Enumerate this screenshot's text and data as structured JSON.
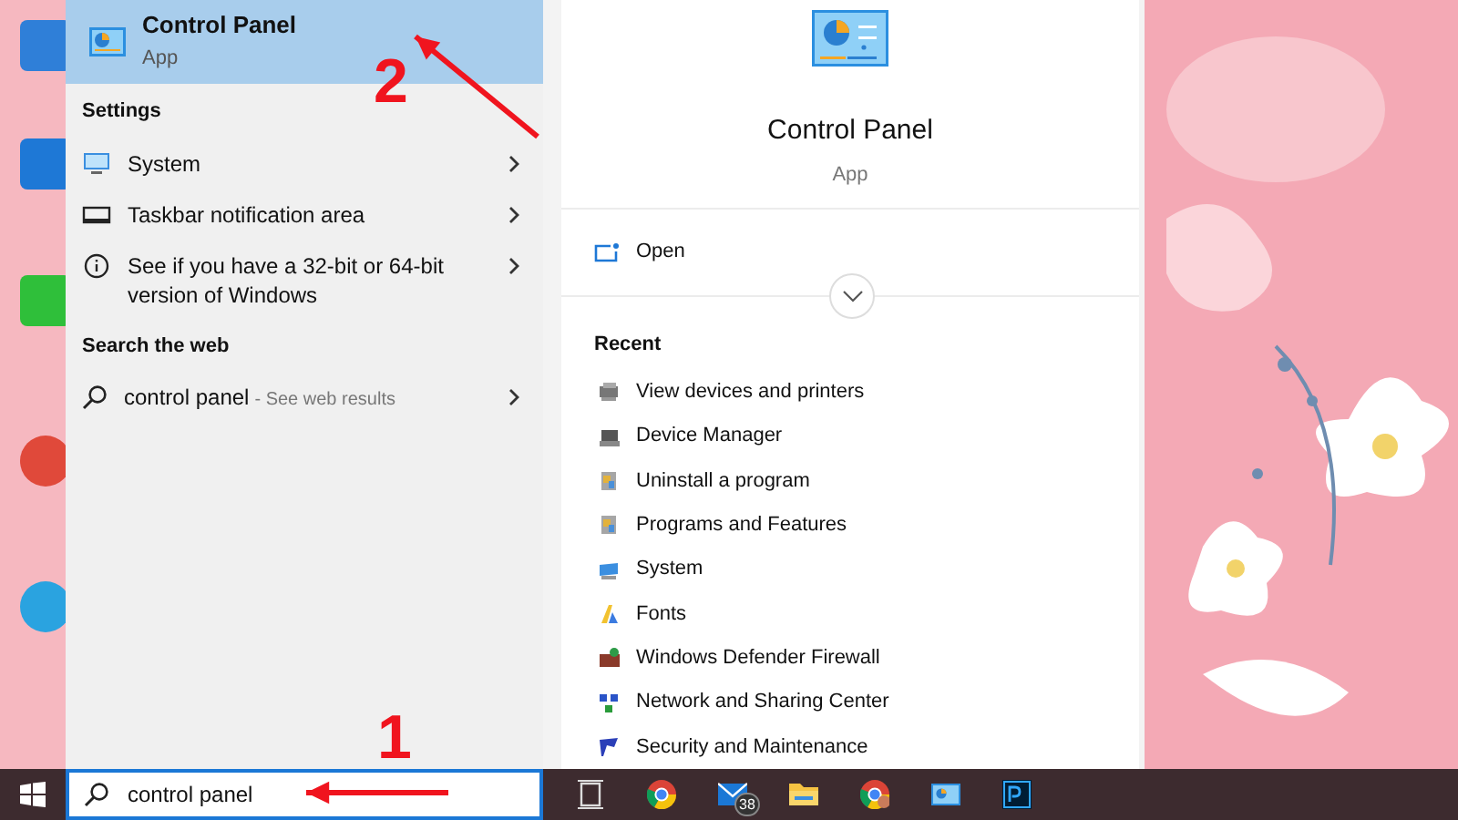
{
  "desktop": {
    "kind": "picture",
    "icons": [
      {
        "kind": "blue"
      },
      {
        "kind": "edge"
      },
      {
        "kind": "green"
      },
      {
        "kind": "chrome"
      },
      {
        "kind": "telegram"
      }
    ]
  },
  "best_match": {
    "title": "Control Panel",
    "subtitle": "App",
    "selected": true
  },
  "settings_heading": "Settings",
  "settings_items": [
    {
      "kind": "system",
      "label": "System"
    },
    {
      "kind": "taskbar",
      "label": "Taskbar notification area"
    },
    {
      "kind": "info",
      "label": "See if you have a 32-bit or 64-bit version of Windows"
    }
  ],
  "web_heading": "Search the web",
  "web_result": {
    "query": "control panel",
    "hint": "- See web results"
  },
  "detail": {
    "title": "Control Panel",
    "subtitle": "App",
    "action": "Open",
    "recent_heading": "Recent",
    "recent": [
      {
        "kind": "devices",
        "label": "View devices and printers"
      },
      {
        "kind": "device-manager",
        "label": "Device Manager"
      },
      {
        "kind": "programs",
        "label": "Uninstall a program"
      },
      {
        "kind": "programs",
        "label": "Programs and Features"
      },
      {
        "kind": "system",
        "label": "System"
      },
      {
        "kind": "fonts",
        "label": "Fonts"
      },
      {
        "kind": "firewall",
        "label": "Windows Defender Firewall"
      },
      {
        "kind": "network",
        "label": "Network and Sharing Center"
      },
      {
        "kind": "security",
        "label": "Security and Maintenance"
      }
    ]
  },
  "search": {
    "value": "control panel"
  },
  "taskbar": {
    "apps": [
      {
        "kind": "task-view"
      },
      {
        "kind": "chrome"
      },
      {
        "kind": "mail",
        "badge": "38"
      },
      {
        "kind": "folder"
      },
      {
        "kind": "chrome-profile"
      },
      {
        "kind": "control-panel"
      },
      {
        "kind": "photoshop"
      }
    ]
  },
  "annotations": [
    {
      "number": "2",
      "kind": "best-match"
    },
    {
      "number": "1",
      "kind": "search"
    }
  ]
}
